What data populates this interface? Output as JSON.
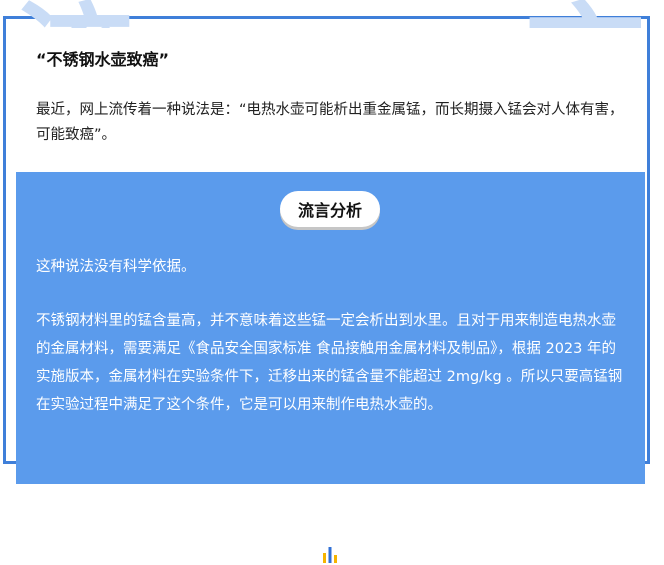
{
  "watermark": {
    "left_char": "流",
    "right_char": "言"
  },
  "rumor": {
    "title": "“不锈钢水壶致癌”",
    "text": "最近，网上流传着一种说法是：“电热水壶可能析出重金属锰，而长期摄入锰会对人体有害，可能致癌”。"
  },
  "analysis": {
    "badge": "流言分析",
    "paragraphs": [
      "这种说法没有科学依据。",
      "不锈钢材料里的锰含量高，并不意味着这些锰一定会析出到水里。且对于用来制造电热水壶的金属材料，需要满足《食品安全国家标准 食品接触用金属材料及制品》，根据 2023 年的实施版本，金属材料在实验条件下，迁移出来的锰含量不能超过 2mg/kg 。所以只要高锰钢在实验过程中满足了这个条件，它是可以用来制作电热水壶的。"
    ]
  },
  "colors": {
    "frame": "#3f7fd9",
    "watermark": "#c9dcf6",
    "analysis_bg": "#5b9bec",
    "logo_yellow": "#f5b400",
    "logo_blue": "#2f6fd6"
  },
  "icons": {
    "footer_logo": "bar-logo-icon"
  }
}
